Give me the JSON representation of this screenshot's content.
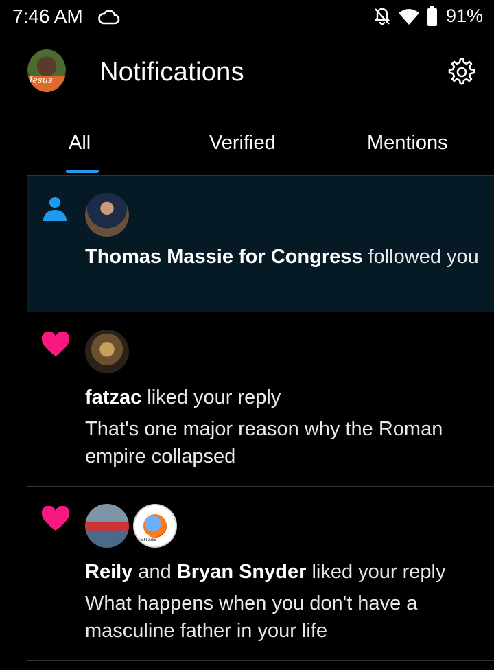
{
  "status_bar": {
    "time": "7:46 AM",
    "battery": "91%",
    "icons": [
      "cloud-icon",
      "bell-off-icon",
      "wifi-icon",
      "battery-icon"
    ]
  },
  "header": {
    "title": "Notifications",
    "avatar_caption": "Jesus",
    "settings_icon": "gear-icon"
  },
  "tabs": [
    {
      "label": "All",
      "selected": true
    },
    {
      "label": "Verified",
      "selected": false
    },
    {
      "label": "Mentions",
      "selected": false
    }
  ],
  "colors": {
    "accent": "#1d9bf0",
    "like": "#f91880",
    "highlight_bg": "#061a25",
    "divider": "#2f3336"
  },
  "notifications": [
    {
      "type_icon": "person-icon",
      "actor": "Thomas Massie for Congress",
      "action": " followed you",
      "snippet": ""
    },
    {
      "type_icon": "heart-icon",
      "actor": "fatzac",
      "action": " liked your reply",
      "snippet": "That's one major reason why the Roman empire collapsed"
    },
    {
      "type_icon": "heart-icon",
      "actor": "Reily",
      "connector": " and ",
      "actor2": "Bryan Snyder",
      "action": " liked your reply",
      "snippet": "What happens when you don't have a masculine father in your life",
      "avatar2_caption": "canvas"
    }
  ]
}
